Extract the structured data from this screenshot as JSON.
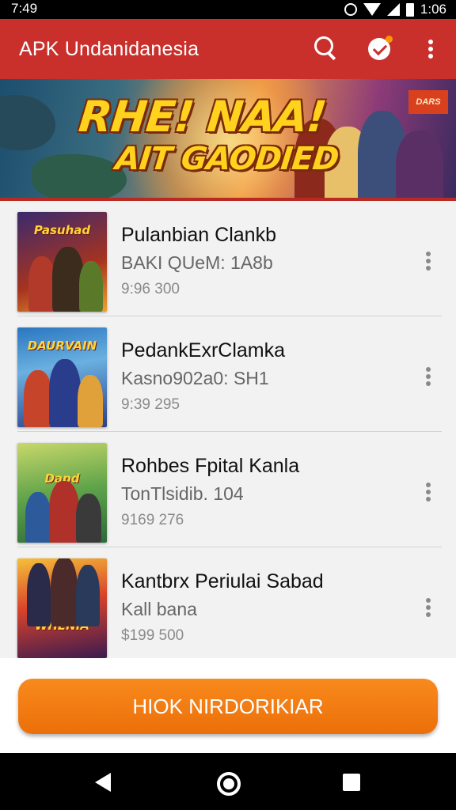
{
  "status_bar": {
    "time": "7:49",
    "clock_time": "1:06"
  },
  "app_bar": {
    "title": "APK Undanidanesia"
  },
  "banner": {
    "headline_line1": "RHE! NAA!",
    "headline_line2": "AIT GAODIED",
    "badge_text": "DARS"
  },
  "items": [
    {
      "name": "Pulanbian Clankb",
      "subtitle": "BAKI QUeM: 1A8b",
      "meta": "9:96 300",
      "thumb_text": "Pasuhad"
    },
    {
      "name": "PedankExrClamka",
      "subtitle": "Kasno902a0: SH1",
      "meta": "9:39 295",
      "thumb_text": "DAURVAIN"
    },
    {
      "name": "Rohbes Fpital Kanla",
      "subtitle": "TonTlsidib. 104",
      "meta": "9169 276",
      "thumb_text": "Dapd"
    },
    {
      "name": "Kantbrx Periulai Sabad",
      "subtitle": "Kall bana",
      "meta": "$199 500",
      "thumb_text": "WHENIA"
    }
  ],
  "cta": {
    "label": "HIOK NIRDORIKIAR"
  },
  "colors": {
    "app_bar": "#c9302c",
    "cta": "#f07a12"
  }
}
